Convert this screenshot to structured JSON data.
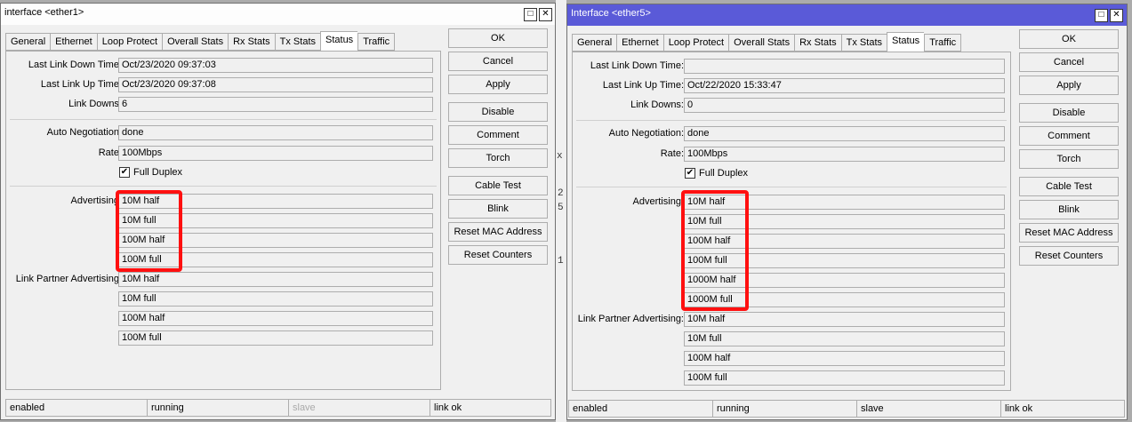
{
  "background": {
    "fragments": [
      "x",
      "2",
      "5",
      "1"
    ]
  },
  "windows": [
    {
      "title": "interface <ether1>",
      "tabs": [
        "General",
        "Ethernet",
        "Loop Protect",
        "Overall Stats",
        "Rx Stats",
        "Tx Stats",
        "Status",
        "Traffic"
      ],
      "active_tab": "Status",
      "fields": {
        "last_link_down_label": "Last Link Down Time:",
        "last_link_down": "Oct/23/2020 09:37:03",
        "last_link_up_label": "Last Link Up Time:",
        "last_link_up": "Oct/23/2020 09:37:08",
        "link_downs_label": "Link Downs:",
        "link_downs": "6",
        "auto_neg_label": "Auto Negotiation:",
        "auto_neg": "done",
        "rate_label": "Rate:",
        "rate": "100Mbps",
        "full_duplex_label": "Full Duplex",
        "advertising_label": "Advertising:",
        "advertising": [
          "10M half",
          "10M full",
          "100M half",
          "100M full"
        ],
        "partner_label": "Link Partner Advertising:",
        "partner": [
          "10M half",
          "10M full",
          "100M half",
          "100M full"
        ]
      },
      "buttons": [
        "OK",
        "Cancel",
        "Apply",
        "Disable",
        "Comment",
        "Torch",
        "Cable Test",
        "Blink",
        "Reset MAC Address",
        "Reset Counters"
      ],
      "status": [
        "enabled",
        "running",
        "slave",
        "link ok"
      ]
    },
    {
      "title": "Interface <ether5>",
      "tabs": [
        "General",
        "Ethernet",
        "Loop Protect",
        "Overall Stats",
        "Rx Stats",
        "Tx Stats",
        "Status",
        "Traffic"
      ],
      "active_tab": "Status",
      "fields": {
        "last_link_down_label": "Last Link Down Time:",
        "last_link_down": "",
        "last_link_up_label": "Last Link Up Time:",
        "last_link_up": "Oct/22/2020 15:33:47",
        "link_downs_label": "Link Downs:",
        "link_downs": "0",
        "auto_neg_label": "Auto Negotiation:",
        "auto_neg": "done",
        "rate_label": "Rate:",
        "rate": "100Mbps",
        "full_duplex_label": "Full Duplex",
        "advertising_label": "Advertising:",
        "advertising": [
          "10M half",
          "10M full",
          "100M half",
          "100M full",
          "1000M half",
          "1000M full"
        ],
        "partner_label": "Link Partner Advertising:",
        "partner": [
          "10M half",
          "10M full",
          "100M half",
          "100M full"
        ]
      },
      "buttons": [
        "OK",
        "Cancel",
        "Apply",
        "Disable",
        "Comment",
        "Torch",
        "Cable Test",
        "Blink",
        "Reset MAC Address",
        "Reset Counters"
      ],
      "status": [
        "enabled",
        "running",
        "slave",
        "link ok"
      ]
    }
  ],
  "colors": {
    "highlight": "#ff1010",
    "titlebar_active": "#5a5ad8"
  }
}
